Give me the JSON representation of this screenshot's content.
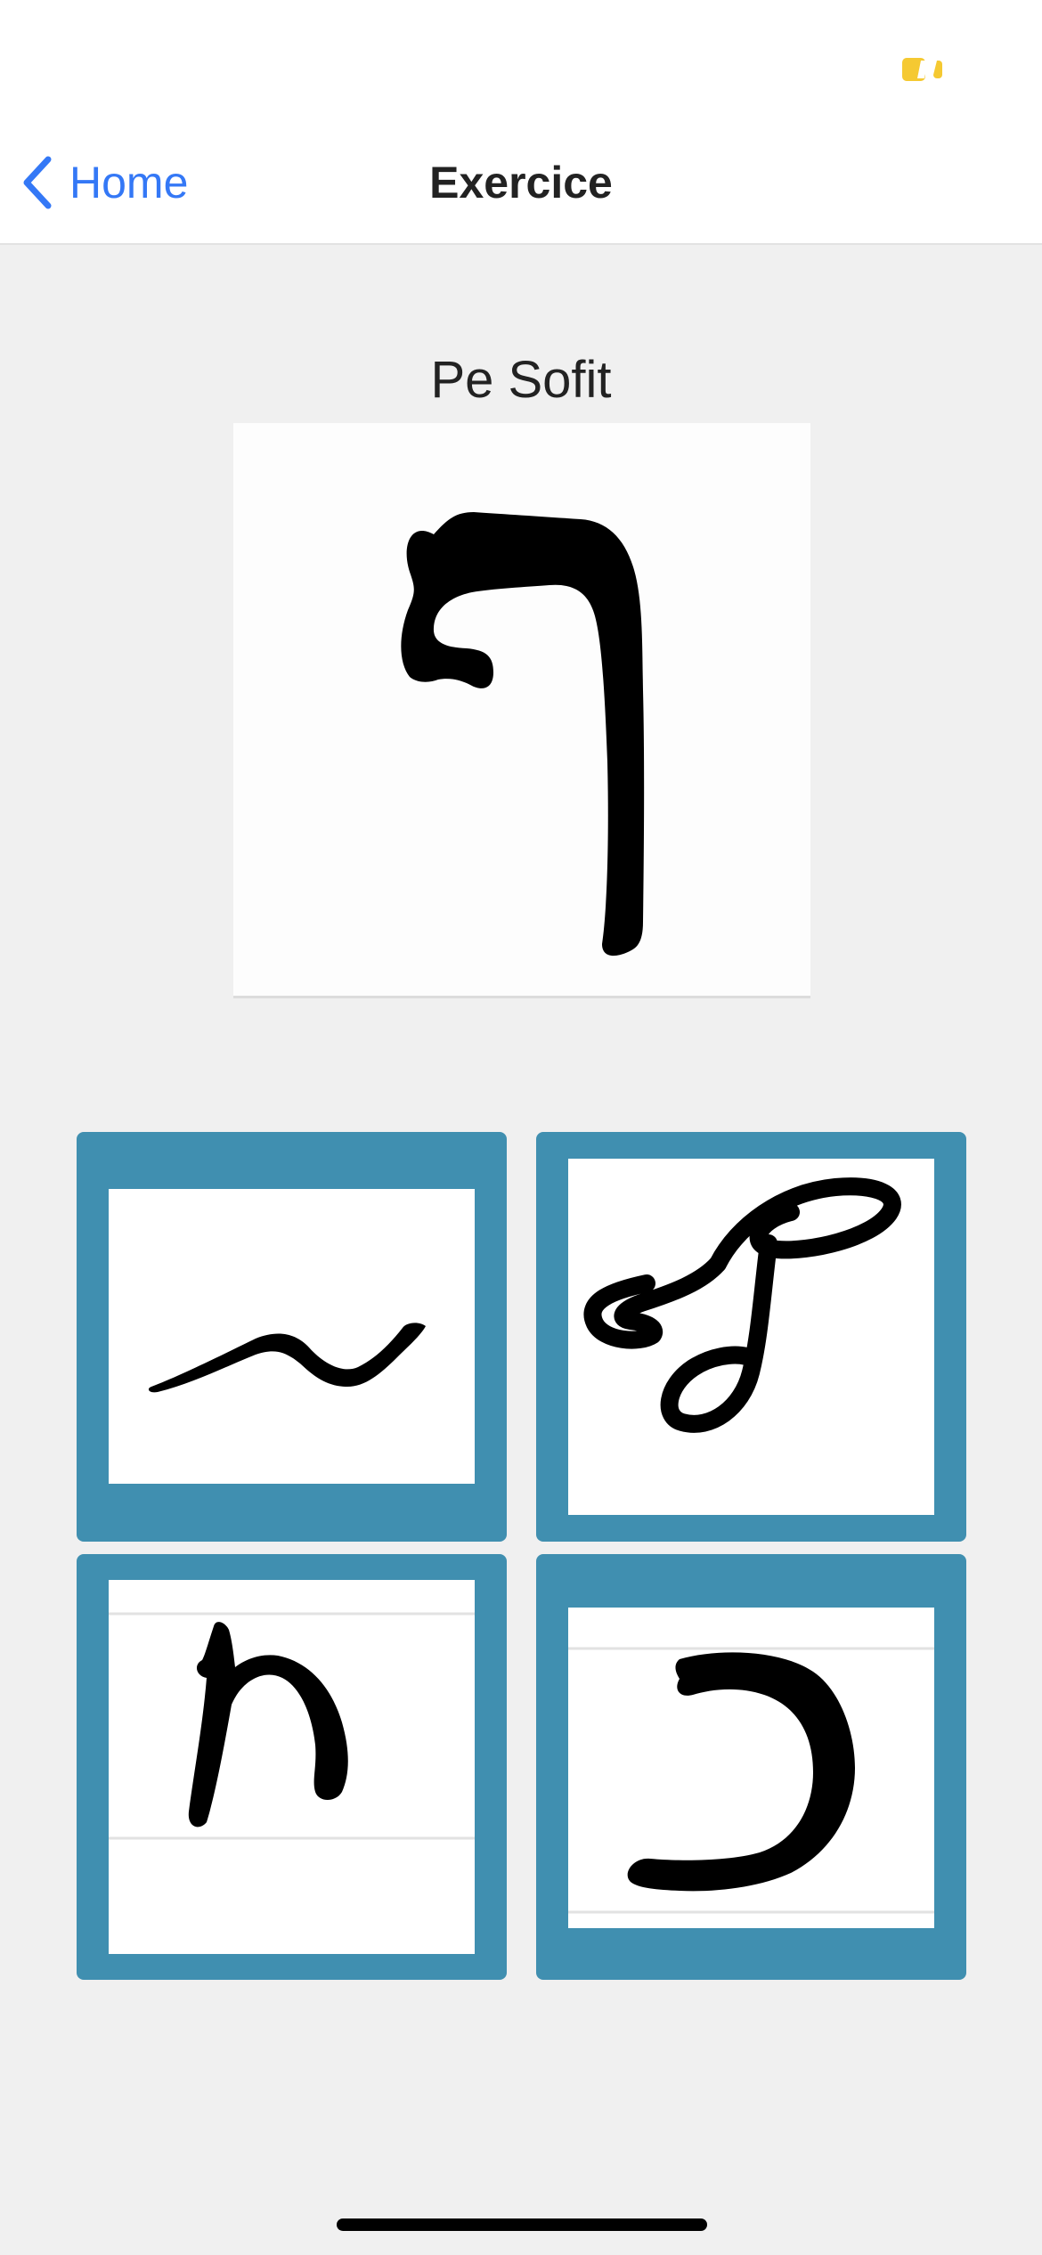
{
  "status_bar": {
    "battery_icon": "battery-low-icon",
    "battery_color": "#f5c932"
  },
  "nav": {
    "back_label": "Home",
    "back_icon": "chevron-left-icon",
    "title": "Exercice",
    "accent_color": "#3478f6"
  },
  "exercise": {
    "prompt": "Pe Sofit",
    "target_glyph": "pe-sofit-handwritten-glyph",
    "answer_tile_color": "#408fb0",
    "answers": [
      {
        "glyph": "tilde-stroke-handwritten-glyph"
      },
      {
        "glyph": "lamed-script-handwritten-glyph"
      },
      {
        "glyph": "alef-script-handwritten-glyph"
      },
      {
        "glyph": "kaf-handwritten-glyph"
      }
    ]
  }
}
